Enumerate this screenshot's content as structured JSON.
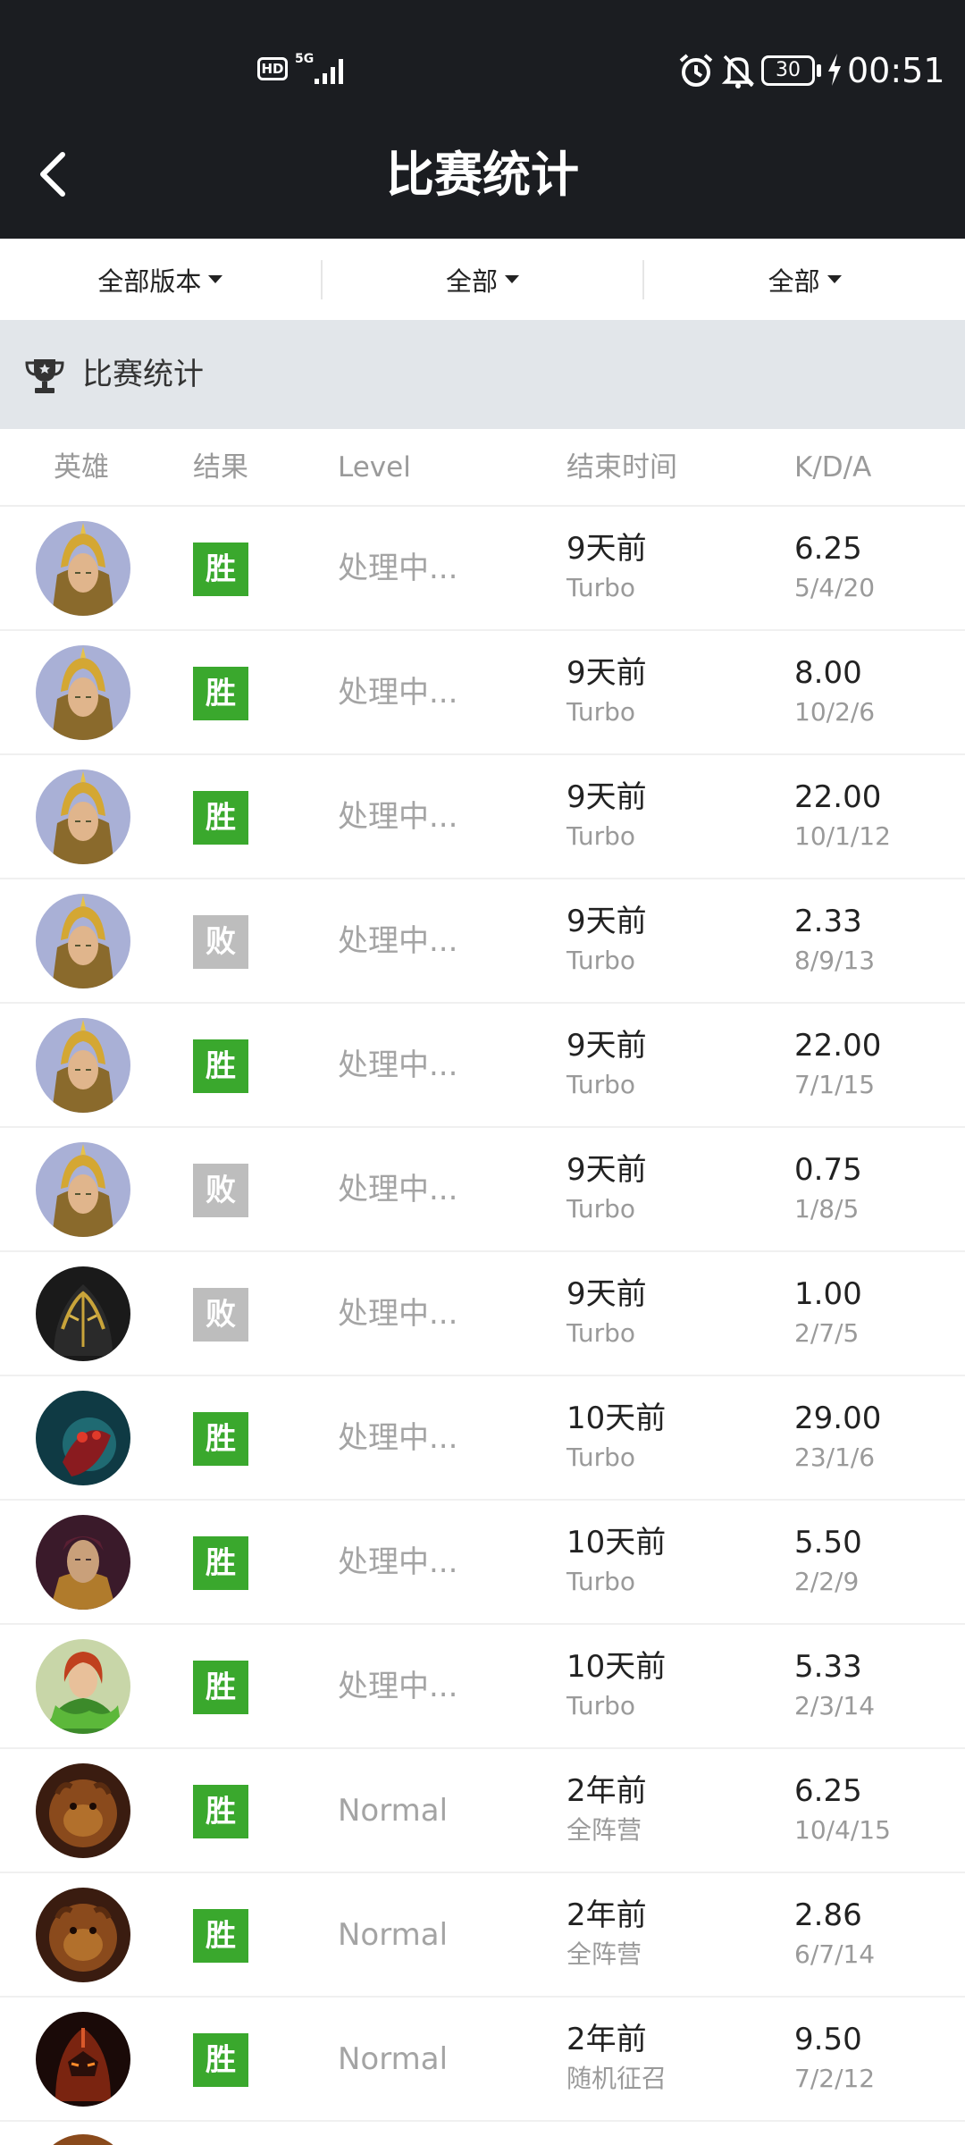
{
  "status_bar": {
    "hd": "HD",
    "network": "5G",
    "battery": "30",
    "time": "00:51"
  },
  "header": {
    "title": "比赛统计"
  },
  "filters": [
    {
      "label": "全部版本"
    },
    {
      "label": "全部"
    },
    {
      "label": "全部"
    }
  ],
  "section": {
    "title": "比赛统计"
  },
  "columns": {
    "hero": "英雄",
    "result": "结果",
    "level": "Level",
    "end_time": "结束时间",
    "kda": "K/D/A"
  },
  "matches": [
    {
      "hero_icon": "knight-hero-avatar",
      "result": "胜",
      "win": true,
      "level": "处理中...",
      "time": "9天前",
      "mode": "Turbo",
      "ratio": "6.25",
      "kda": "5/4/20"
    },
    {
      "hero_icon": "knight-hero-avatar",
      "result": "胜",
      "win": true,
      "level": "处理中...",
      "time": "9天前",
      "mode": "Turbo",
      "ratio": "8.00",
      "kda": "10/2/6"
    },
    {
      "hero_icon": "knight-hero-avatar",
      "result": "胜",
      "win": true,
      "level": "处理中...",
      "time": "9天前",
      "mode": "Turbo",
      "ratio": "22.00",
      "kda": "10/1/12"
    },
    {
      "hero_icon": "knight-hero-avatar",
      "result": "败",
      "win": false,
      "level": "处理中...",
      "time": "9天前",
      "mode": "Turbo",
      "ratio": "2.33",
      "kda": "8/9/13"
    },
    {
      "hero_icon": "knight-hero-avatar",
      "result": "胜",
      "win": true,
      "level": "处理中...",
      "time": "9天前",
      "mode": "Turbo",
      "ratio": "22.00",
      "kda": "7/1/15"
    },
    {
      "hero_icon": "knight-hero-avatar",
      "result": "败",
      "win": false,
      "level": "处理中...",
      "time": "9天前",
      "mode": "Turbo",
      "ratio": "0.75",
      "kda": "1/8/5"
    },
    {
      "hero_icon": "dark-armor-hero-avatar",
      "result": "败",
      "win": false,
      "level": "处理中...",
      "time": "9天前",
      "mode": "Turbo",
      "ratio": "1.00",
      "kda": "2/7/5"
    },
    {
      "hero_icon": "insect-hero-avatar",
      "result": "胜",
      "win": true,
      "level": "处理中...",
      "time": "10天前",
      "mode": "Turbo",
      "ratio": "29.00",
      "kda": "23/1/6"
    },
    {
      "hero_icon": "mage-hero-avatar",
      "result": "胜",
      "win": true,
      "level": "处理中...",
      "time": "10天前",
      "mode": "Turbo",
      "ratio": "5.50",
      "kda": "2/2/9"
    },
    {
      "hero_icon": "ranger-hero-avatar",
      "result": "胜",
      "win": true,
      "level": "处理中...",
      "time": "10天前",
      "mode": "Turbo",
      "ratio": "5.33",
      "kda": "2/3/14"
    },
    {
      "hero_icon": "beast-hero-avatar",
      "result": "胜",
      "win": true,
      "level": "Normal",
      "time": "2年前",
      "mode": "全阵营",
      "ratio": "6.25",
      "kda": "10/4/15"
    },
    {
      "hero_icon": "beast-hero-avatar",
      "result": "胜",
      "win": true,
      "level": "Normal",
      "time": "2年前",
      "mode": "全阵营",
      "ratio": "2.86",
      "kda": "6/7/14"
    },
    {
      "hero_icon": "dragon-knight-hero-avatar",
      "result": "胜",
      "win": true,
      "level": "Normal",
      "time": "2年前",
      "mode": "随机征召",
      "ratio": "9.50",
      "kda": "7/2/12"
    }
  ],
  "colors": {
    "header_bg": "#1b1d21",
    "section_bg": "#e2e6ea",
    "win": "#3aa82d",
    "loss": "#bdbdbd"
  }
}
